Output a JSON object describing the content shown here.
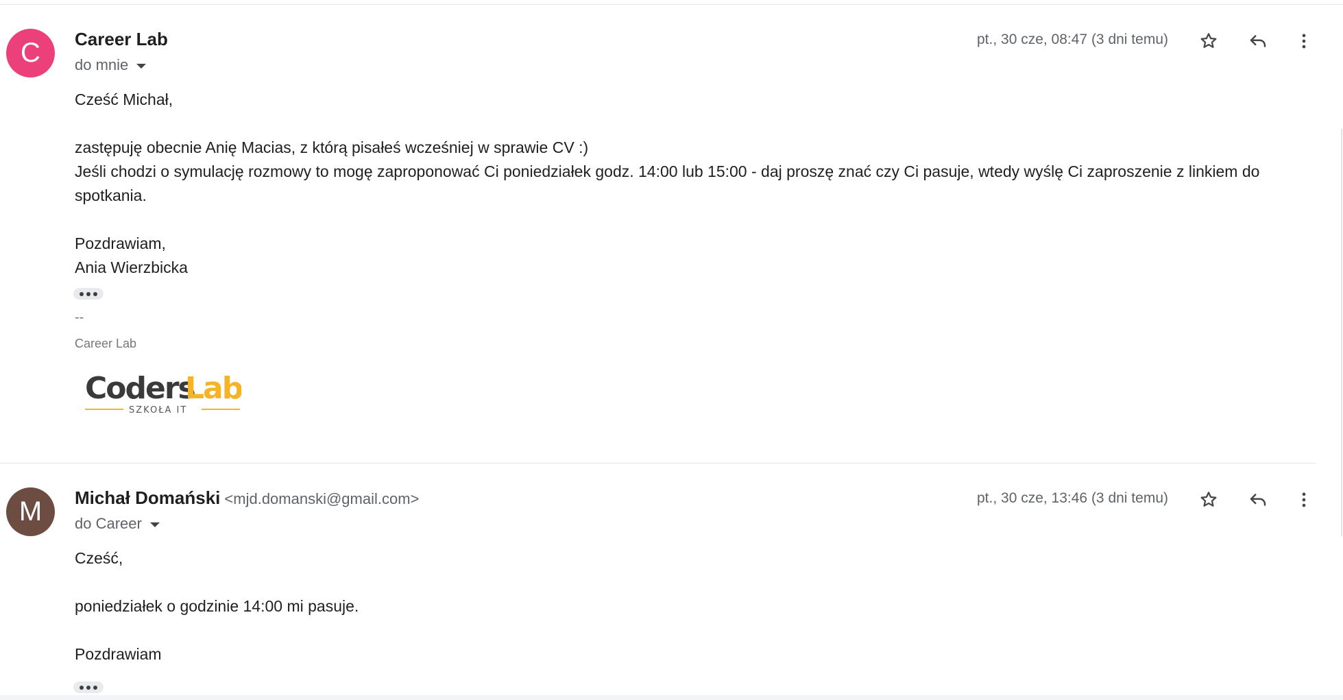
{
  "messages": [
    {
      "avatar_letter": "C",
      "avatar_color": "#ec407a",
      "sender_name": "Career Lab",
      "sender_email": "",
      "recipient": "do mnie",
      "date": "pt., 30 cze, 08:47 (3 dni temu)",
      "body": {
        "greeting": "Cześć Michał,",
        "line1": "zastępuję obecnie Anię Macias, z którą pisałeś wcześniej w sprawie CV :)",
        "line2": "Jeśli chodzi o symulację rozmowy to mogę zaproponować Ci poniedziałek godz. 14:00 lub 15:00 - daj proszę znać czy Ci pasuje, wtedy wyślę Ci zaproszenie z linkiem do spotkania.",
        "closing": "Pozdrawiam,",
        "signature": "Ania Wierzbicka"
      },
      "sig_separator": "--",
      "sig_company": "Career Lab",
      "logo": {
        "word1": "Coders",
        "word2": "Lab",
        "tagline": "SZKOŁA IT",
        "text_color": "#3a3a3a",
        "accent_color": "#f5b325"
      }
    },
    {
      "avatar_letter": "M",
      "avatar_color": "#6d4c41",
      "sender_name": "Michał Domański",
      "sender_email": "<mjd.domanski@gmail.com>",
      "recipient": "do Career",
      "date": "pt., 30 cze, 13:46 (3 dni temu)",
      "body": {
        "greeting": "Cześć,",
        "line1": "poniedziałek o godzinie 14:00 mi pasuje.",
        "closing": "Pozdrawiam"
      }
    }
  ],
  "icons": {
    "star": "star-outline-icon",
    "reply": "reply-icon",
    "more": "more-vert-icon"
  },
  "colors": {
    "icon": "#444746",
    "secondary_text": "#5f6368"
  }
}
